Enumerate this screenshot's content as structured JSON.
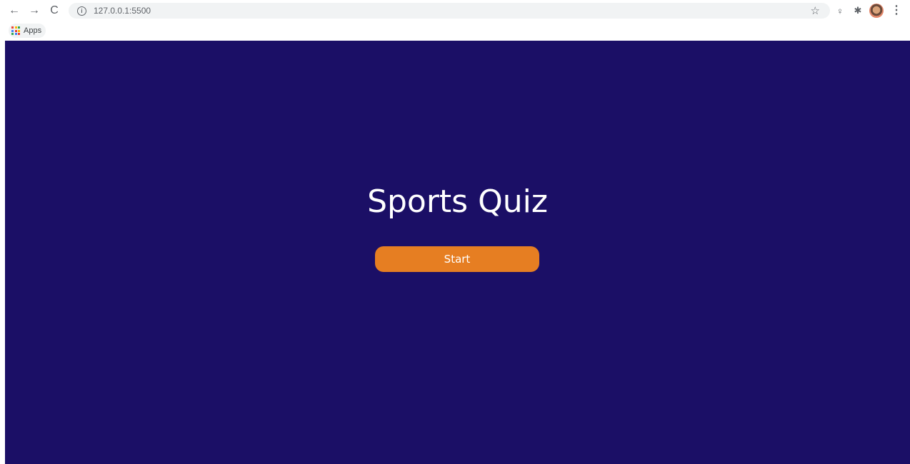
{
  "browser": {
    "nav": {
      "back": "←",
      "forward": "→",
      "reload": "C"
    },
    "address_bar": {
      "url": "127.0.0.1:5500",
      "info_glyph": "i",
      "star_glyph": "☆"
    },
    "extensions": {
      "extension_a_glyph": "♀",
      "puzzle_glyph": "✱"
    },
    "menu_glyph": "⋮",
    "bookmarks": {
      "apps_label": "Apps",
      "apps_colors": [
        "#ea4335",
        "#fbbc04",
        "#34a853",
        "#4285f4",
        "#ea4335",
        "#fbbc04",
        "#34a853",
        "#4285f4",
        "#ea4335"
      ]
    }
  },
  "page": {
    "background_color": "#1b0f66",
    "title": "Sports Quiz",
    "start_button_label": "Start",
    "accent_color": "#e67e22"
  }
}
